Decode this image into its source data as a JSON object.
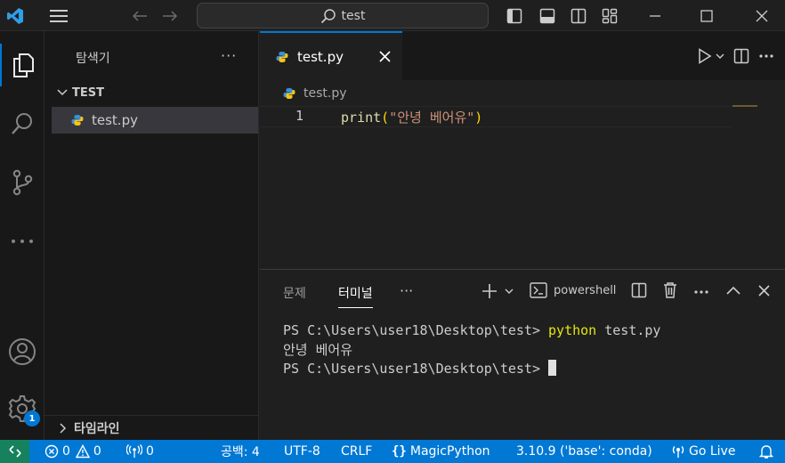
{
  "titlebar": {
    "search_text": "test"
  },
  "activity": {
    "accounts_badge": "1"
  },
  "sidebar": {
    "title": "탐색기",
    "more": "···",
    "folder_name": "TEST",
    "file_name": "test.py",
    "timeline_label": "타임라인"
  },
  "editor": {
    "tab_label": "test.py",
    "breadcrumb_file": "test.py",
    "line_number": "1",
    "code": {
      "fn": "print",
      "open": "(",
      "str": "\"안녕 베어유\"",
      "close": ")"
    }
  },
  "panel": {
    "tabs": [
      "문제",
      "터미널"
    ],
    "more": "···",
    "shell_label": "powershell",
    "terminal": {
      "line1_prompt": "PS C:\\Users\\user18\\Desktop\\test> ",
      "line1_cmd": "python",
      "line1_args": " test.py",
      "line2": "안녕 베어유",
      "line3_prompt": "PS C:\\Users\\user18\\Desktop\\test> "
    }
  },
  "statusbar": {
    "errors": "0",
    "warnings": "0",
    "ports": "0",
    "spaces": "공백: 4",
    "encoding": "UTF-8",
    "eol": "CRLF",
    "language": "MagicPython",
    "interpreter": "3.10.9 ('base': conda)",
    "golive": "Go Live"
  },
  "colors": {
    "accent": "#0078d4",
    "remote": "#16825d",
    "string": "#ce9178",
    "function": "#dcdcaa"
  }
}
